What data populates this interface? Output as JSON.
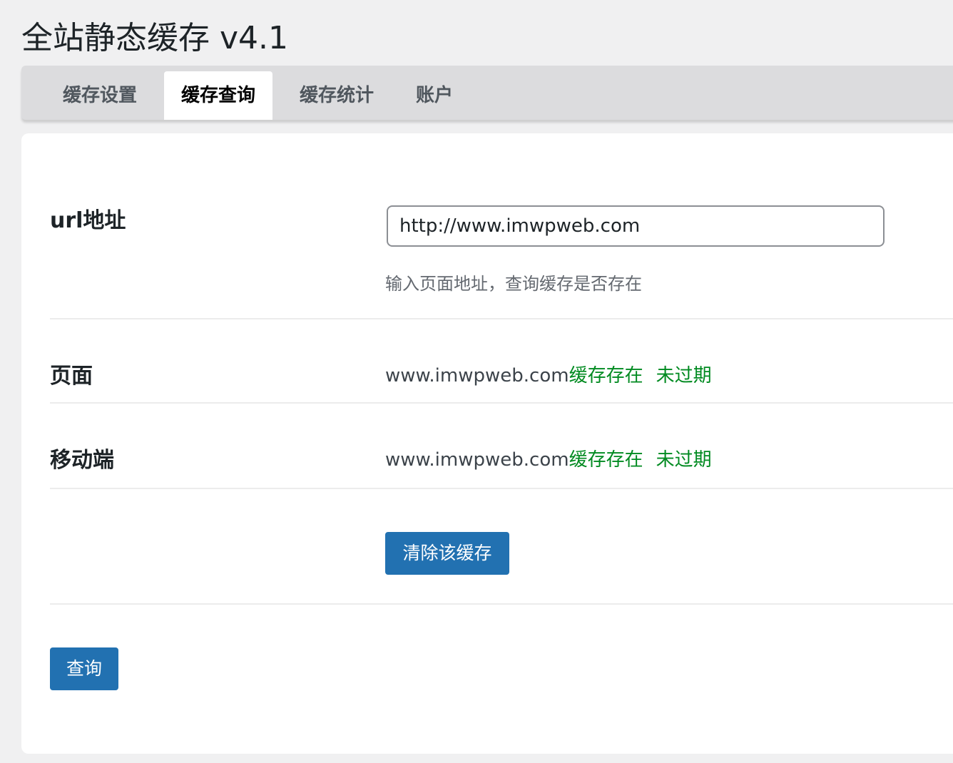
{
  "app": {
    "title": "全站静态缓存 v4.1"
  },
  "tabs": [
    {
      "label": "缓存设置",
      "active": false
    },
    {
      "label": "缓存查询",
      "active": true
    },
    {
      "label": "缓存统计",
      "active": false
    },
    {
      "label": "账户",
      "active": false
    }
  ],
  "form": {
    "url_label": "url地址",
    "url_value": "http://www.imwpweb.com",
    "url_help": "输入页面地址，查询缓存是否存在"
  },
  "results": [
    {
      "label": "页面",
      "domain": "www.imwpweb.com",
      "status": "缓存存在",
      "expiry": "未过期"
    },
    {
      "label": "移动端",
      "domain": "www.imwpweb.com",
      "status": "缓存存在",
      "expiry": "未过期"
    }
  ],
  "buttons": {
    "clear_cache": "清除该缓存",
    "query": "查询"
  },
  "colors": {
    "primary_button": "#2271b1",
    "status_green": "#008a20",
    "tab_bar": "#dcdcde",
    "page_background": "#f0f0f1"
  }
}
